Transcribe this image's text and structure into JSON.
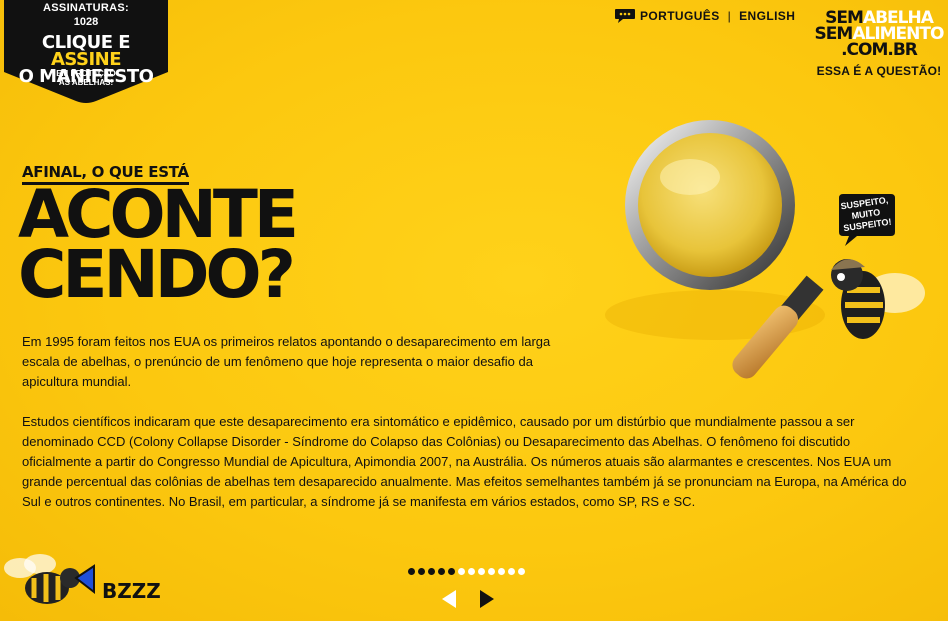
{
  "manifest": {
    "count_label": "ASSINATURAS:",
    "count_value": "1028",
    "cta_part1": "CLIQUE E ",
    "cta_part2": "ASSINE",
    "cta_line2": "O MANIFESTO",
    "sub_line1": "EM PROTEÇÃO",
    "sub_line2": "ÀS ABELHAS!"
  },
  "language": {
    "portuguese": "PORTUGUÊS",
    "separator": "|",
    "english": "ENGLISH"
  },
  "logo": {
    "line1_a": "SEM",
    "line1_b": "ABELHA",
    "line2_a": "SEM",
    "line2_b": "ALIMENTO",
    "line3": ".COM.BR",
    "tagline": "ESSA É A QUESTÃO!"
  },
  "illustration": {
    "bubble_line1": "SUSPEITO,",
    "bubble_line2": "MUITO",
    "bubble_line3": "SUSPEITO!"
  },
  "content": {
    "kicker": "AFINAL, O QUE ESTÁ",
    "headline_line1": "ACONTE",
    "headline_line2": "CENDO?",
    "paragraph1": "Em 1995 foram feitos nos EUA os primeiros relatos apontando o desaparecimento em larga escala de abelhas, o prenúncio de um fenômeno que hoje representa o maior desafio da apicultura mundial.",
    "paragraph2": "Estudos científicos indicaram que este desaparecimento era sintomático e epidêmico, causado por um distúrbio que mundialmente passou a ser denominado CCD (Colony Collapse Disorder - Síndrome do Colapso das Colônias) ou Desaparecimento das Abelhas. O fenômeno foi discutido oficialmente a partir do Congresso Mundial de Apicultura, Apimondia 2007, na Austrália. Os números atuais são alarmantes e crescentes. Nos EUA um grande percentual das colônias de abelhas tem desaparecido anualmente. Mas efeitos semelhantes também já se pronunciam na Europa, na América do Sul e outros continentes. No Brasil, em particular, a síndrome já se manifesta em vários estados, como SP, RS e SC."
  },
  "bzzz": {
    "label": "BZZZ"
  },
  "pager": {
    "total": 12,
    "current": 5
  },
  "colors": {
    "background": "#fcc80f",
    "text": "#111111",
    "accent": "#ffd21a"
  }
}
